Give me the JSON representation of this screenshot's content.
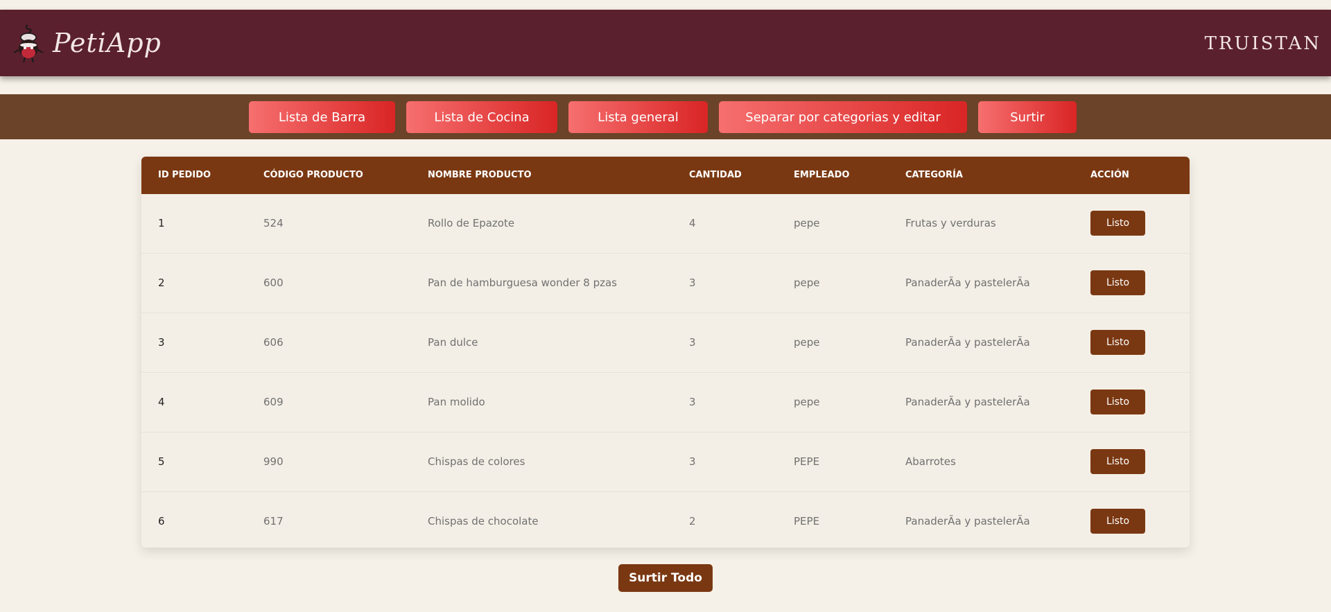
{
  "header": {
    "app_name": "PetiApp",
    "user_name": "TRUISTAN"
  },
  "nav": {
    "buttons": [
      {
        "label": "Lista de Barra"
      },
      {
        "label": "Lista de Cocina"
      },
      {
        "label": "Lista general"
      },
      {
        "label": "Separar por categorias y editar"
      },
      {
        "label": "Surtir"
      }
    ]
  },
  "table": {
    "headers": [
      "ID PEDIDO",
      "CÓDIGO PRODUCTO",
      "NOMBRE PRODUCTO",
      "CANTIDAD",
      "EMPLEADO",
      "CATEGORÍA",
      "ACCIÓN"
    ],
    "rows": [
      {
        "id": "1",
        "codigo": "524",
        "nombre": "Rollo de Epazote",
        "cantidad": "4",
        "empleado": "pepe",
        "categoria": "Frutas y verduras",
        "accion": "Listo"
      },
      {
        "id": "2",
        "codigo": "600",
        "nombre": "Pan de hamburguesa wonder 8 pzas",
        "cantidad": "3",
        "empleado": "pepe",
        "categoria": "PanaderÃa y pastelerÃa",
        "accion": "Listo"
      },
      {
        "id": "3",
        "codigo": "606",
        "nombre": "Pan dulce",
        "cantidad": "3",
        "empleado": "pepe",
        "categoria": "PanaderÃa y pastelerÃa",
        "accion": "Listo"
      },
      {
        "id": "4",
        "codigo": "609",
        "nombre": "Pan molido",
        "cantidad": "3",
        "empleado": "pepe",
        "categoria": "PanaderÃa y pastelerÃa",
        "accion": "Listo"
      },
      {
        "id": "5",
        "codigo": "990",
        "nombre": "Chispas de colores",
        "cantidad": "3",
        "empleado": "PEPE",
        "categoria": "Abarrotes",
        "accion": "Listo"
      },
      {
        "id": "6",
        "codigo": "617",
        "nombre": "Chispas de chocolate",
        "cantidad": "2",
        "empleado": "PEPE",
        "categoria": "PanaderÃa y pastelerÃa",
        "accion": "Listo"
      }
    ]
  },
  "footer": {
    "surtir_todo_label": "Surtir Todo"
  },
  "colors": {
    "header_bg": "#5b202d",
    "nav_bg": "#6b4328",
    "accent_brown": "#7a3812",
    "nav_button_red": "#e23b3b",
    "page_bg": "#f6f1e8"
  },
  "icons": {
    "logo": "chef-character-icon"
  }
}
